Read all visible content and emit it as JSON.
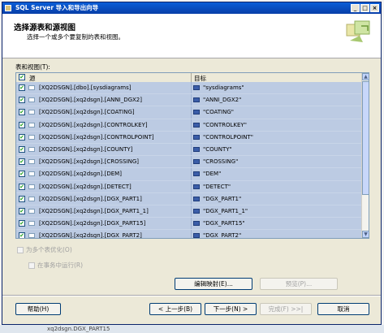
{
  "window": {
    "title": "SQL Server 导入和导出向导",
    "title_buttons": {
      "minimize": "_",
      "maximize": "□",
      "close": "×"
    }
  },
  "header": {
    "title": "选择源表和源视图",
    "subtitle": "选择一个或多个要复制的表和视图。"
  },
  "tables_label": "表和视图(T):",
  "grid": {
    "columns": {
      "source": "源",
      "destination": "目标"
    },
    "rows": [
      {
        "source": "[XQ2DSGN].[dbo].[sysdiagrams]",
        "destination": "\"sysdiagrams\""
      },
      {
        "source": "[XQ2DSGN].[xq2dsgn].[ANNI_DGX2]",
        "destination": "\"ANNI_DGX2\""
      },
      {
        "source": "[XQ2DSGN].[xq2dsgn].[COATING]",
        "destination": "\"COATING\""
      },
      {
        "source": "[XQ2DSGN].[xq2dsgn].[CONTROLKEY]",
        "destination": "\"CONTROLKEY\""
      },
      {
        "source": "[XQ2DSGN].[xq2dsgn].[CONTROLPOINT]",
        "destination": "\"CONTROLPOINT\""
      },
      {
        "source": "[XQ2DSGN].[xq2dsgn].[COUNTY]",
        "destination": "\"COUNTY\""
      },
      {
        "source": "[XQ2DSGN].[xq2dsgn].[CROSSING]",
        "destination": "\"CROSSING\""
      },
      {
        "source": "[XQ2DSGN].[xq2dsgn].[DEM]",
        "destination": "\"DEM\""
      },
      {
        "source": "[XQ2DSGN].[xq2dsgn].[DETECT]",
        "destination": "\"DETECT\""
      },
      {
        "source": "[XQ2DSGN].[xq2dsgn].[DGX_PART1]",
        "destination": "\"DGX_PART1\""
      },
      {
        "source": "[XQ2DSGN].[xq2dsgn].[DGX_PART1_1]",
        "destination": "\"DGX_PART1_1\""
      },
      {
        "source": "[XQ2DSGN].[xq2dsgn].[DGX_PART15]",
        "destination": "\"DGX_PART15\""
      },
      {
        "source": "[XQ2DSGN].[xq2dsgn].[DGX_PART2]",
        "destination": "\"DGX_PART2\""
      }
    ]
  },
  "options": {
    "optimize_multiple": "为多个表优化(O)",
    "run_in_transaction": "在事务中运行(R)"
  },
  "buttons": {
    "edit_mappings": "编辑映射(E)...",
    "preview": "预览(P)...",
    "help": "帮助(H)",
    "back": "< 上一步(B)",
    "next": "下一步(N) >",
    "finish": "完成(F) >>|",
    "cancel": "取消"
  },
  "backdrop_text": "xq2dsgn.DGX_PART15",
  "colors": {
    "titlebar": "#0a5ed7",
    "row_selected": "#bccbe3",
    "dialog": "#ece9d8"
  },
  "icons": {
    "checked": "✔",
    "scroll_up": "▲",
    "scroll_down": "▼"
  }
}
